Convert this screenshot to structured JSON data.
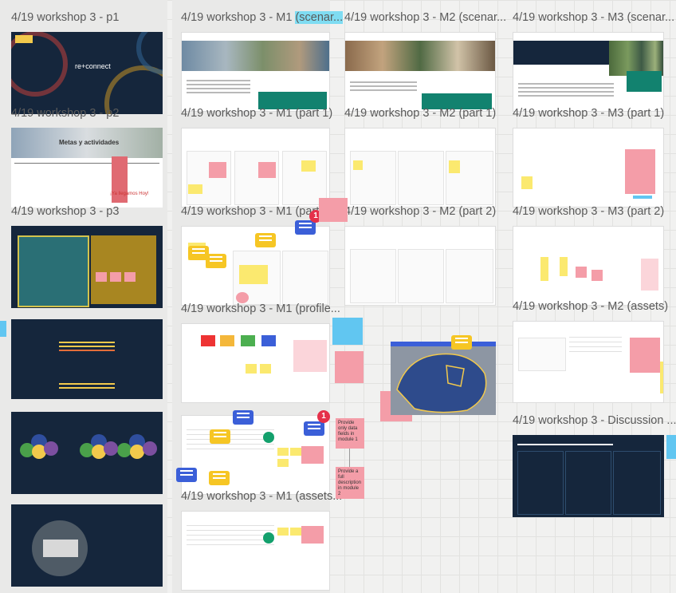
{
  "frames": [
    {
      "id": "c1r1",
      "title": "4/19 workshop 3 - p1"
    },
    {
      "id": "c1r2",
      "title": "4/19 workshop 3 - p2"
    },
    {
      "id": "c1r3",
      "title": "4/19 workshop 3 - p3"
    },
    {
      "id": "c2r1",
      "title": "4/19 workshop 3 - M1 (scenar..."
    },
    {
      "id": "c2r2",
      "title": "4/19 workshop 3 - M1 (part 1)"
    },
    {
      "id": "c2r3",
      "title": "4/19 workshop 3 - M1 (part 2)"
    },
    {
      "id": "c2r4",
      "title": "4/19 workshop 3 - M1 (profile..."
    },
    {
      "id": "c2r6",
      "title": "4/19 workshop 3 - M1 (assets..."
    },
    {
      "id": "c3r1",
      "title": "4/19 workshop 3 - M2 (scenar..."
    },
    {
      "id": "c3r2",
      "title": "4/19 workshop 3 - M2 (part 1)"
    },
    {
      "id": "c3r3",
      "title": "4/19 workshop 3 - M2 (part 2)"
    },
    {
      "id": "c4r1",
      "title": "4/19 workshop 3 - M3 (scenar..."
    },
    {
      "id": "c4r2",
      "title": "4/19 workshop 3 - M3 (part 1)"
    },
    {
      "id": "c4r3",
      "title": "4/19 workshop 3 - M3 (part 2)"
    },
    {
      "id": "c4r4",
      "title": "4/19 workshop 3 - M2 (assets)"
    },
    {
      "id": "c4r5",
      "title": "4/19 workshop 3 - Discussion ..."
    }
  ],
  "slides": {
    "p1_logo": "re+connect",
    "p2_title": "Metas y actividades",
    "p2_note": "¡Ya llegamos Hoy!"
  },
  "stickies": {
    "m2_note": "Provide only data fields in module 1",
    "m2_note2": "Provide a full description in module 2"
  },
  "badges": {
    "count_a": "1",
    "count_b": "1"
  },
  "colors": {
    "dark_slide": "#15263c",
    "highlight": "#7fdcf2",
    "sticky_yellow": "#fbe96f",
    "sticky_pink": "#f49da8",
    "teal": "#12826f"
  }
}
